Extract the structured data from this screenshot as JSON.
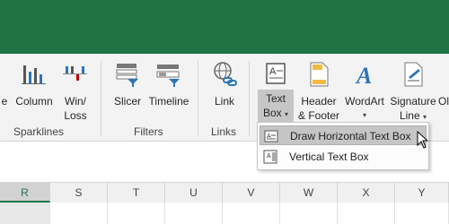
{
  "ribbon": {
    "sparklines": {
      "group_label": "Sparklines",
      "line_partial": "e",
      "column": "Column",
      "winloss_line1": "Win/",
      "winloss_line2": "Loss"
    },
    "filters": {
      "group_label": "Filters",
      "slicer": "Slicer",
      "timeline": "Timeline"
    },
    "links": {
      "group_label": "Links",
      "link": "Link"
    },
    "text": {
      "textbox_line1": "Text",
      "textbox_line2": "Box",
      "header_line1": "Header",
      "header_line2": "& Footer",
      "wordart": "WordArt",
      "signature_line1": "Signature",
      "signature_line2": "Line",
      "partial": "Ol"
    }
  },
  "textbox_menu": {
    "items": [
      {
        "label": "Draw Horizontal Text Box",
        "highlighted": true
      },
      {
        "label": "Vertical Text Box",
        "highlighted": false
      }
    ]
  },
  "columns": [
    "R",
    "S",
    "T",
    "U",
    "V",
    "W",
    "X",
    "Y"
  ],
  "selected_column": "R",
  "colors": {
    "accent": "#217346",
    "ribbon_bg": "#f3f3f3"
  }
}
